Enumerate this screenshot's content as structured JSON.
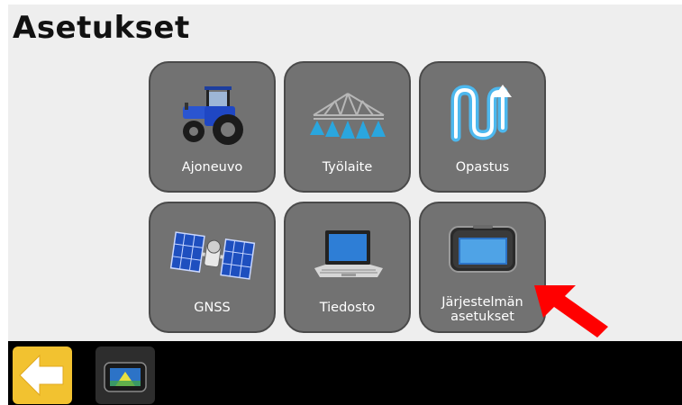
{
  "header": {
    "title": "Asetukset"
  },
  "tiles": [
    {
      "label": "Ajoneuvo",
      "icon": "tractor-icon"
    },
    {
      "label": "Työlaite",
      "icon": "sprayer-boom-icon"
    },
    {
      "label": "Opastus",
      "icon": "guidance-pattern-icon"
    },
    {
      "label": "GNSS",
      "icon": "satellite-icon"
    },
    {
      "label": "Tiedosto",
      "icon": "laptop-icon"
    },
    {
      "label_line1": "Järjestelmän",
      "label_line2": "asetukset",
      "icon": "display-console-icon"
    }
  ],
  "annotation": {
    "icon": "red-arrow-icon",
    "color": "#ff0000"
  },
  "bottom_bar": {
    "back_icon": "back-arrow-icon",
    "display_icon": "display-console-icon",
    "back_color": "#f2c230"
  }
}
